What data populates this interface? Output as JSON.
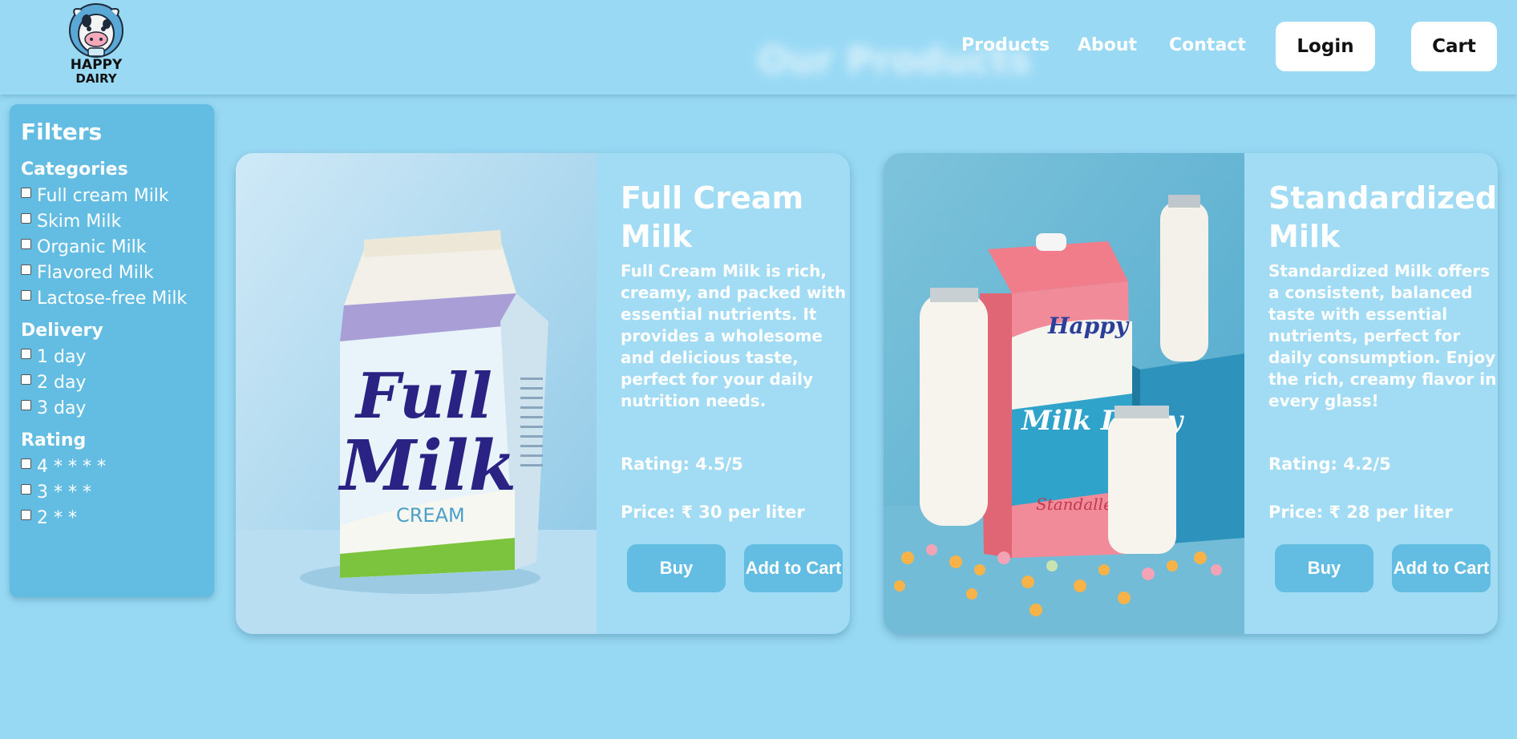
{
  "header": {
    "logo_line1": "HAPPY",
    "logo_line2": "DAIRY",
    "background_title": "Our Products",
    "nav": [
      "Products",
      "About",
      "Contact"
    ],
    "login_label": "Login",
    "cart_label": "Cart"
  },
  "sidebar": {
    "title": "Filters",
    "categories": {
      "heading": "Categories",
      "items": [
        "Full cream Milk",
        "Skim Milk",
        "Organic Milk",
        "Flavored Milk",
        "Lactose-free Milk"
      ]
    },
    "delivery": {
      "heading": "Delivery",
      "items": [
        "1 day",
        "2 day",
        "3 day"
      ]
    },
    "rating": {
      "heading": "Rating",
      "items": [
        "4 * * * *",
        "3 * * *",
        "2 * *"
      ]
    }
  },
  "products": [
    {
      "title": "Full Cream Milk",
      "description": "Full Cream Milk is rich, creamy, and packed with essential nutrients. It provides a wholesome and delicious taste, perfect for your daily nutrition needs.",
      "rating": "Rating: 4.5/5",
      "price": "Price: ₹ 30 per liter",
      "buy_label": "Buy",
      "add_label": "Add to Cart",
      "image_text_1": "Full",
      "image_text_2": "Milk",
      "image_text_3": "CREAM"
    },
    {
      "title": "Standardized Milk",
      "description": "Standardized Milk offers a consistent, balanced taste with essential nutrients, perfect for daily consumption. Enjoy the rich, creamy flavor in every glass!",
      "rating": "Rating: 4.2/5",
      "price": "Price: ₹ 28 per liter",
      "buy_label": "Buy",
      "add_label": "Add to Cart",
      "image_text_1": "Happy",
      "image_text_2": "Milk Dairy",
      "image_text_3": "Standalle"
    }
  ],
  "colors": {
    "page_bg": "#97d8f3",
    "panel": "#63bde2",
    "card_bg": "#a2dbf4",
    "text": "#ffffff"
  }
}
